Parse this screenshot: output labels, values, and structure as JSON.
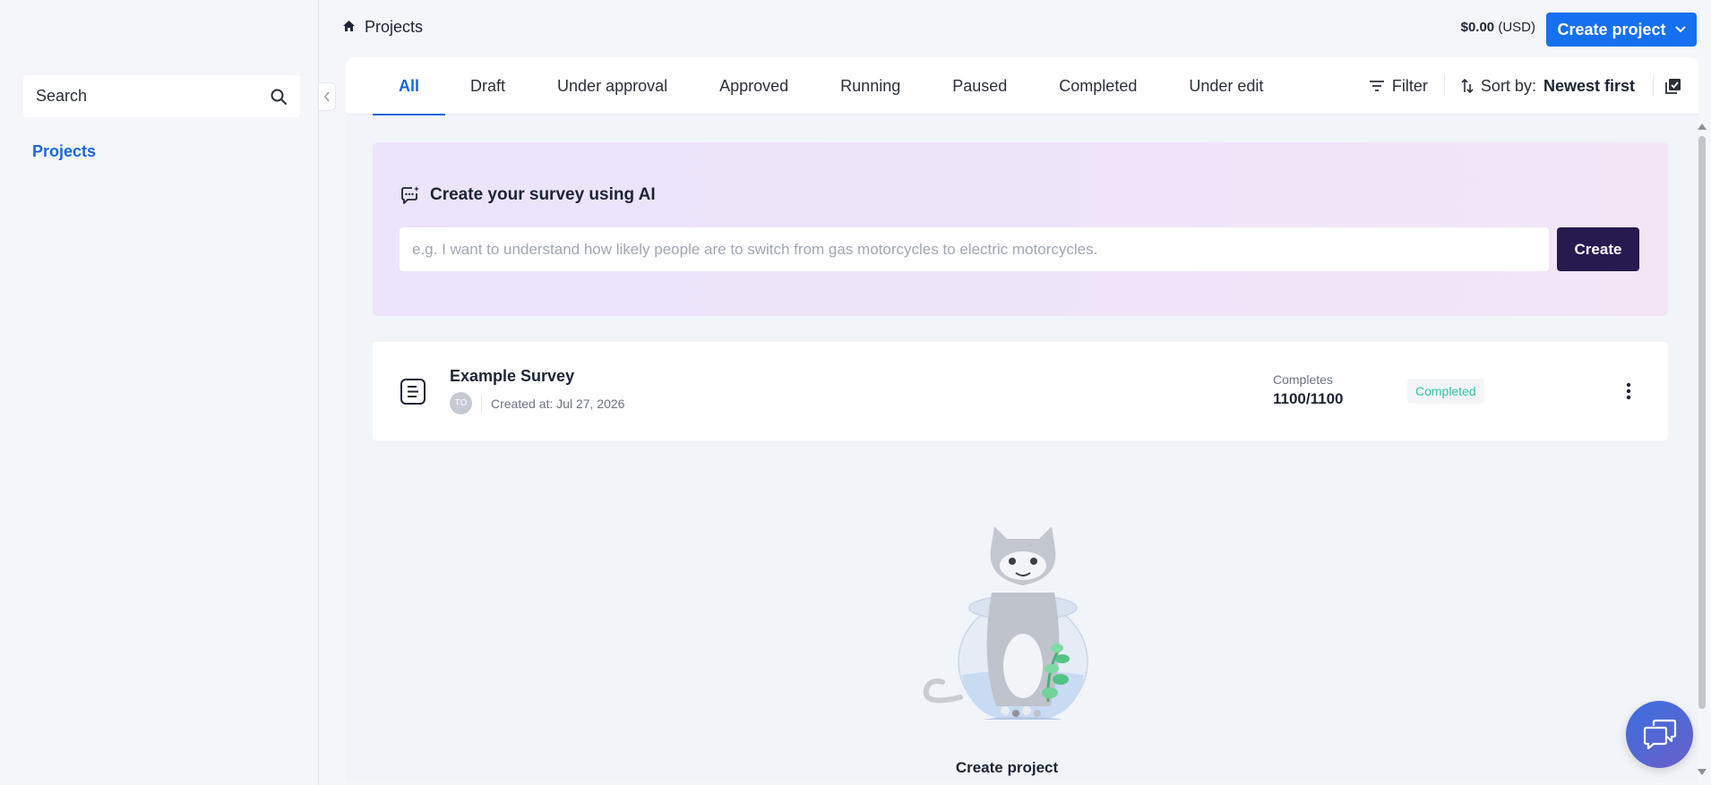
{
  "sidebar": {
    "search_placeholder": "Search",
    "nav_projects": "Projects"
  },
  "header": {
    "breadcrumb": "Projects",
    "balance_amount": "$0.00",
    "balance_currency": "(USD)",
    "create_project_label": "Create project"
  },
  "tabs": [
    "All",
    "Draft",
    "Under approval",
    "Approved",
    "Running",
    "Paused",
    "Completed",
    "Under edit"
  ],
  "active_tab": "All",
  "toolbar": {
    "filter_label": "Filter",
    "sort_label": "Sort by:",
    "sort_value": "Newest first"
  },
  "ai_card": {
    "title": "Create your survey using AI",
    "input_placeholder": "e.g. I want to understand how likely people are to switch from gas motorcycles to electric motorcycles.",
    "create_label": "Create"
  },
  "project": {
    "title": "Example Survey",
    "owner_initials": "TO",
    "created_at": "Created at: Jul 27, 2026",
    "completes_label": "Completes",
    "completes_value": "1100/1100",
    "status": "Completed"
  },
  "empty_state": {
    "label": "Create project"
  },
  "colors": {
    "primary": "#1570ef",
    "active_tab": "#1a66d8",
    "ai_button": "#261a4f",
    "status_completed": "#2ec4a0"
  },
  "icons": [
    "menu-grip-icon",
    "search-icon",
    "chevron-left-icon",
    "home-icon",
    "chevron-down-icon",
    "filter-icon",
    "sort-icon",
    "bulk-select-icon",
    "ai-chat-icon",
    "document-icon",
    "kebab-icon",
    "chat-icon"
  ]
}
